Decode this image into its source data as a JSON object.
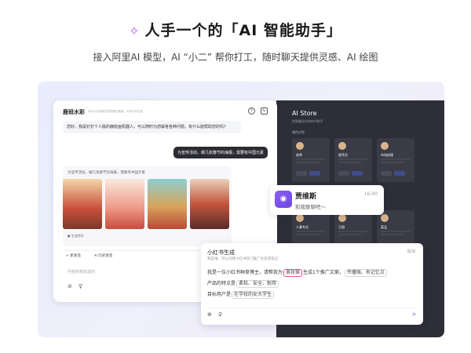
{
  "hero": {
    "spark_icon": "sparkle-wand-icon",
    "title": "人手一个的「AI 智能助手」",
    "subtitle": "接入阿里AI 模型，AI “小二” 帮你打工，随时聊天提供灵感、AI 绘图"
  },
  "store": {
    "title": "AI Store",
    "subtitle": "找到最适合你的AI助手",
    "section": "角色对话",
    "cards": [
      {
        "name": "老师"
      },
      {
        "name": "程序员"
      },
      {
        "name": "市场经理"
      },
      {
        "name": "人事专员"
      },
      {
        "name": "万相"
      },
      {
        "name": "菜品"
      }
    ]
  },
  "chat": {
    "name": "鹿班水彩",
    "hint": "你可以向我描述你想要的画面，AI将为你生成",
    "help_icon": "question-icon",
    "edit_icon": "edit-icon",
    "greeting": "您好，我是钉钉个人版的鹿班画机器人。可以随时为您解答各种问题，有什么能帮助您的吗?",
    "user_msg": "为宣传活动，做几张春节的海报，需要有中国元素",
    "gen_prompt": "为宣传活动，做几张春节的海报，需要有中国元素",
    "gen_footer": "● 生成完毕",
    "chip_new": "+ 新会话",
    "chip_history": "⟲ 历史会话",
    "input_placeholder": "问我你想知道的",
    "attach_icon": "paperclip-icon",
    "bulb_icon": "bulb-icon"
  },
  "contact": {
    "name": "贾维斯",
    "time": "16:00",
    "message": "和我聊聊吧～"
  },
  "writer": {
    "title": "小红书生成",
    "cancel": "取消",
    "desc": "我是谁，可以创建小红书热门推广文案或笔记",
    "line1_pre": "我是一位小红书种草博主，请帮我为",
    "line1_tag": "美妆案",
    "line1_post": "生成1个推广文案，",
    "line1_tag2": "传播强、有记忆点",
    "line2_pre": "产品的特点是",
    "line2_tag1": "柔软、安全、耐用",
    "line3_pre": "目标用户是",
    "line3_tag": "在学校的女大学生",
    "add_icon": "plus-circle-icon",
    "bulb_icon": "bulb-icon",
    "send_icon": "send-icon"
  }
}
